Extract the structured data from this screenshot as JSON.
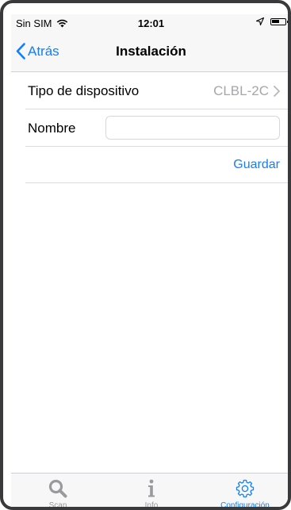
{
  "status_bar": {
    "carrier": "Sin SIM",
    "time": "12:01"
  },
  "nav": {
    "back_label": "Atrás",
    "title": "Instalación"
  },
  "form": {
    "device_type_label": "Tipo de dispositivo",
    "device_type_value": "CLBL-2C",
    "name_label": "Nombre",
    "name_value": "",
    "name_placeholder": "",
    "save_label": "Guardar"
  },
  "tabs": [
    {
      "label": "Scan",
      "icon": "search-icon",
      "active": false
    },
    {
      "label": "Info",
      "icon": "info-icon",
      "active": false
    },
    {
      "label": "Configuración",
      "icon": "gear-icon",
      "active": true
    }
  ],
  "colors": {
    "accent": "#147efb",
    "inactive_tab": "#9a9a9e",
    "secondary_text": "#a6a6ab"
  }
}
